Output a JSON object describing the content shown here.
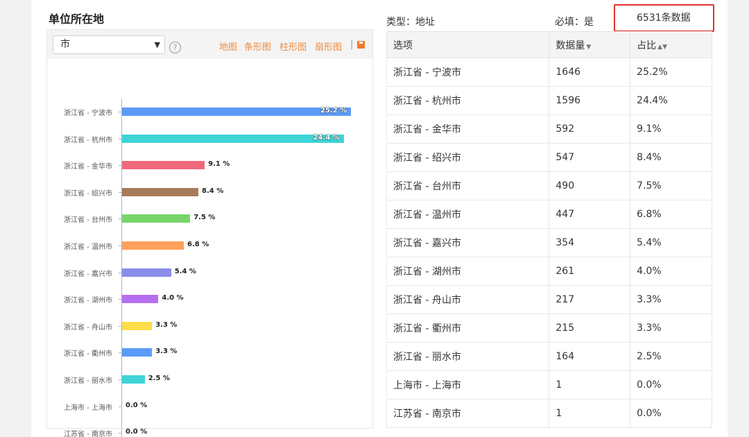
{
  "section": {
    "title": "单位所在地"
  },
  "controls": {
    "level_select": "市",
    "help_icon": "question-circle-icon",
    "chart_tabs": [
      "地图",
      "条形图",
      "柱形图",
      "扇形图"
    ],
    "tab_separator": "|",
    "save_icon": "save-icon"
  },
  "meta": {
    "type": "类型：地址",
    "required": "必填：是",
    "count": "6531条数据"
  },
  "table": {
    "headers": [
      "选项",
      "数据量",
      "占比"
    ],
    "rows": [
      [
        "浙江省 - 宁波市",
        "1646",
        "25.2%"
      ],
      [
        "浙江省 - 杭州市",
        "1596",
        "24.4%"
      ],
      [
        "浙江省 - 金华市",
        "592",
        "9.1%"
      ],
      [
        "浙江省 - 绍兴市",
        "547",
        "8.4%"
      ],
      [
        "浙江省 - 台州市",
        "490",
        "7.5%"
      ],
      [
        "浙江省 - 温州市",
        "447",
        "6.8%"
      ],
      [
        "浙江省 - 嘉兴市",
        "354",
        "5.4%"
      ],
      [
        "浙江省 - 湖州市",
        "261",
        "4.0%"
      ],
      [
        "浙江省 - 舟山市",
        "217",
        "3.3%"
      ],
      [
        "浙江省 - 衢州市",
        "215",
        "3.3%"
      ],
      [
        "浙江省 - 丽水市",
        "164",
        "2.5%"
      ],
      [
        "上海市 - 上海市",
        "1",
        "0.0%"
      ],
      [
        "江苏省 - 南京市",
        "1",
        "0.0%"
      ]
    ]
  },
  "chart_data": {
    "type": "bar",
    "orientation": "horizontal",
    "categories": [
      "浙江省 - 宁波市",
      "浙江省 - 杭州市",
      "浙江省 - 金华市",
      "浙江省 - 绍兴市",
      "浙江省 - 台州市",
      "浙江省 - 温州市",
      "浙江省 - 嘉兴市",
      "浙江省 - 湖州市",
      "浙江省 - 舟山市",
      "浙江省 - 衢州市",
      "浙江省 - 丽水市",
      "上海市 - 上海市",
      "江苏省 - 南京市"
    ],
    "values": [
      25.2,
      24.4,
      9.1,
      8.4,
      7.5,
      6.8,
      5.4,
      4.0,
      3.3,
      3.3,
      2.5,
      0.0,
      0.0
    ],
    "value_labels": [
      "25.2 %",
      "24.4 %",
      "9.1 %",
      "8.4 %",
      "7.5 %",
      "6.8 %",
      "5.4 %",
      "4.0 %",
      "3.3 %",
      "3.3 %",
      "2.5 %",
      "0.0 %",
      "0.0 %"
    ],
    "colors": [
      "#5b9bf8",
      "#3fd4d6",
      "#f0697a",
      "#a87b5a",
      "#78d56a",
      "#ffa05c",
      "#8a8ee8",
      "#b66ff0",
      "#fedd4a",
      "#5b9bf8",
      "#3fd4d6",
      "#f0697a",
      "#a87b5a"
    ],
    "xlim": [
      0,
      25.2
    ],
    "grid": false,
    "legend": "none"
  }
}
